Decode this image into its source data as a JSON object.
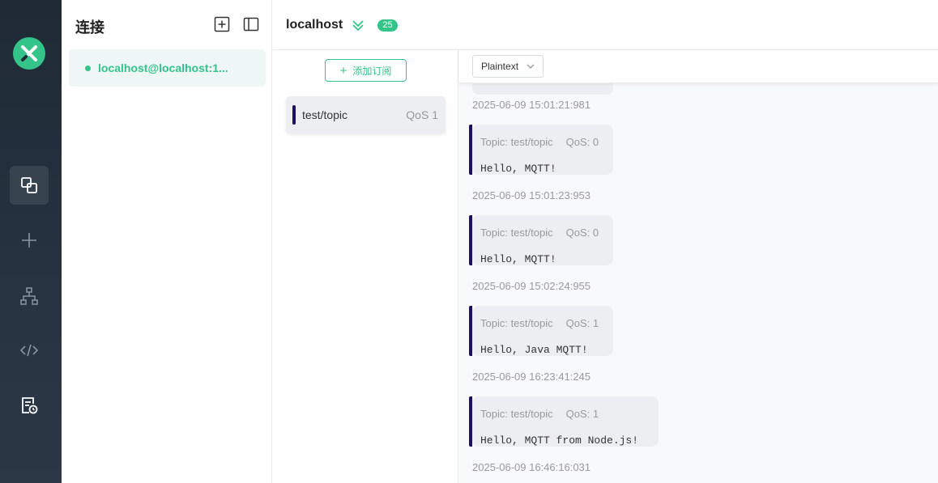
{
  "app": {
    "rail": {
      "items": [
        {
          "name": "connections",
          "icon": "connections-icon",
          "active": true
        },
        {
          "name": "new",
          "icon": "plus-icon"
        },
        {
          "name": "topology",
          "icon": "hierarchy-icon"
        },
        {
          "name": "script",
          "icon": "code-icon"
        },
        {
          "name": "log",
          "icon": "log-icon"
        }
      ],
      "accent": "#34c388"
    },
    "connections": {
      "title": "连接",
      "items": [
        {
          "label": "localhost@localhost:1...",
          "status": "connected"
        }
      ]
    },
    "header": {
      "title": "localhost",
      "badge": "25"
    },
    "subscriptions": {
      "add_label": "添加订阅",
      "items": [
        {
          "topic": "test/topic",
          "qos": "QoS 1",
          "color": "#1d1064"
        }
      ]
    },
    "messages": {
      "format": "Plaintext",
      "first_time": "2025-06-09 15:01:21:981",
      "list": [
        {
          "topic": "Topic: test/topic",
          "qos": "QoS: 0",
          "payload": "Hello, MQTT!",
          "time": "2025-06-09 15:01:23:953"
        },
        {
          "topic": "Topic: test/topic",
          "qos": "QoS: 0",
          "payload": "Hello, MQTT!",
          "time": "2025-06-09 15:02:24:955"
        },
        {
          "topic": "Topic: test/topic",
          "qos": "QoS: 1",
          "payload": "Hello, Java MQTT!",
          "time": "2025-06-09 16:23:41:245"
        },
        {
          "topic": "Topic: test/topic",
          "qos": "QoS: 1",
          "payload": "Hello, MQTT from Node.js!",
          "time": "2025-06-09 16:46:16:031"
        }
      ]
    }
  }
}
